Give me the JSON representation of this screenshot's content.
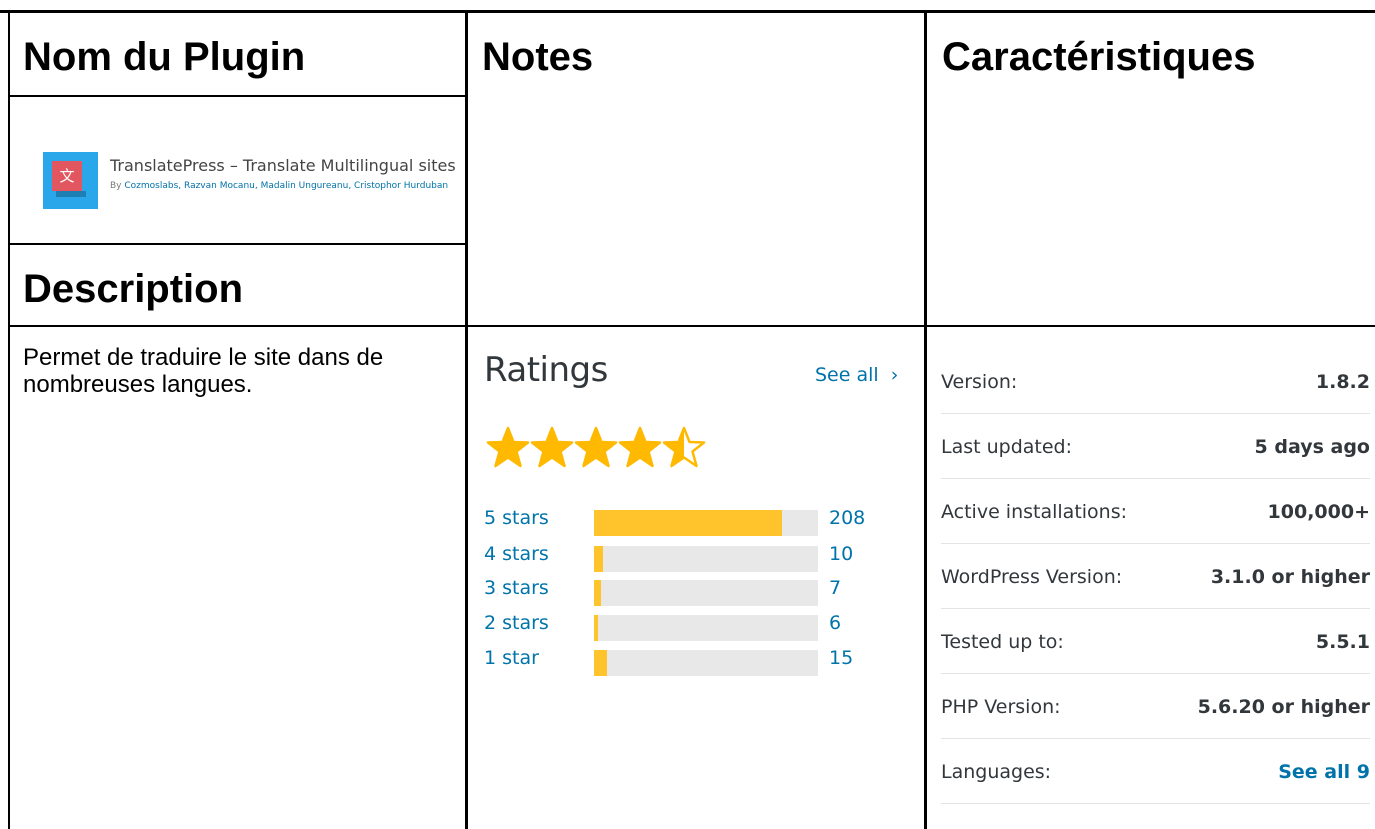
{
  "table": {
    "headers": {
      "plugin_name": "Nom du Plugin",
      "notes": "Notes",
      "features": "Caractéristiques",
      "description": "Description"
    }
  },
  "plugin": {
    "name": "TranslatePress – Translate Multilingual sites",
    "by_prefix": "By",
    "authors": "Cozmoslabs, Razvan Mocanu, Madalin Ungureanu, Cristophor Hurduban",
    "icon": "translate-icon",
    "icon_glyph": "文",
    "icon_colors": {
      "background": "#2aa6ea",
      "square": "#e2575f"
    }
  },
  "description_text": "Permet de traduire le site dans de nombreuses langues.",
  "ratings": {
    "title": "Ratings",
    "see_all": "See all",
    "see_all_chevron": "›",
    "average_stars": 4.5,
    "max_stars": 5,
    "star_color": "#ffb900",
    "bar_color": "#ffc42b",
    "rows": [
      {
        "label": "5 stars",
        "count": "208",
        "fill": 0.84
      },
      {
        "label": "4 stars",
        "count": "10",
        "fill": 0.04
      },
      {
        "label": "3 stars",
        "count": "7",
        "fill": 0.03
      },
      {
        "label": "2 stars",
        "count": "6",
        "fill": 0.02
      },
      {
        "label": "1 star",
        "count": "15",
        "fill": 0.06
      }
    ]
  },
  "meta": [
    {
      "label": "Version:",
      "value": "1.8.2",
      "link": false
    },
    {
      "label": "Last updated:",
      "value": "5 days ago",
      "link": false
    },
    {
      "label": "Active installations:",
      "value": "100,000+",
      "link": false
    },
    {
      "label": "WordPress Version:",
      "value": "3.1.0 or higher",
      "link": false
    },
    {
      "label": "Tested up to:",
      "value": "5.5.1",
      "link": false
    },
    {
      "label": "PHP Version:",
      "value": "5.6.20 or higher",
      "link": false
    },
    {
      "label": "Languages:",
      "value": "See all 9",
      "link": true
    }
  ]
}
